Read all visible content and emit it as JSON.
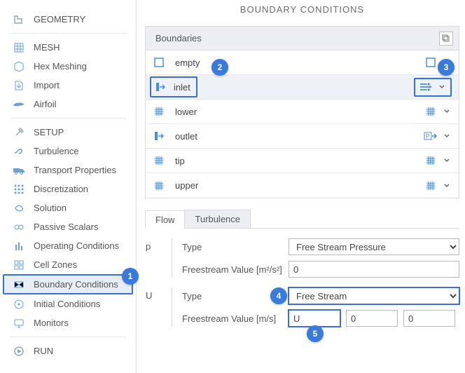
{
  "page_title": "BOUNDARY CONDITIONS",
  "sidebar": {
    "geometry": "GEOMETRY",
    "mesh": "MESH",
    "hexMeshing": "Hex Meshing",
    "import": "Import",
    "airfoil": "Airfoil",
    "setup": "SETUP",
    "turbulence": "Turbulence",
    "transportProperties": "Transport Properties",
    "discretization": "Discretization",
    "solution": "Solution",
    "passiveScalars": "Passive Scalars",
    "operatingConditions": "Operating Conditions",
    "cellZones": "Cell Zones",
    "boundaryConditions": "Boundary Conditions",
    "initialConditions": "Initial Conditions",
    "monitors": "Monitors",
    "run": "RUN"
  },
  "panel": {
    "header": "Boundaries",
    "rows": {
      "empty": "empty",
      "inlet": "inlet",
      "lower": "lower",
      "outlet": "outlet",
      "tip": "tip",
      "upper": "upper"
    }
  },
  "tabs": {
    "flow": "Flow",
    "turbulence": "Turbulence"
  },
  "form": {
    "p": {
      "var": "p",
      "typeLabel": "Type",
      "typeValue": "Free Stream Pressure",
      "fvLabel": "Freestream Value [m²/s²]",
      "fvValue": "0"
    },
    "u": {
      "var": "U",
      "typeLabel": "Type",
      "typeValue": "Free Stream",
      "fvLabel": "Freestream Value [m/s]",
      "vx": "U",
      "vy": "0",
      "vz": "0"
    }
  },
  "callouts": {
    "c1": "1",
    "c2": "2",
    "c3": "3",
    "c4": "4",
    "c5": "5"
  }
}
